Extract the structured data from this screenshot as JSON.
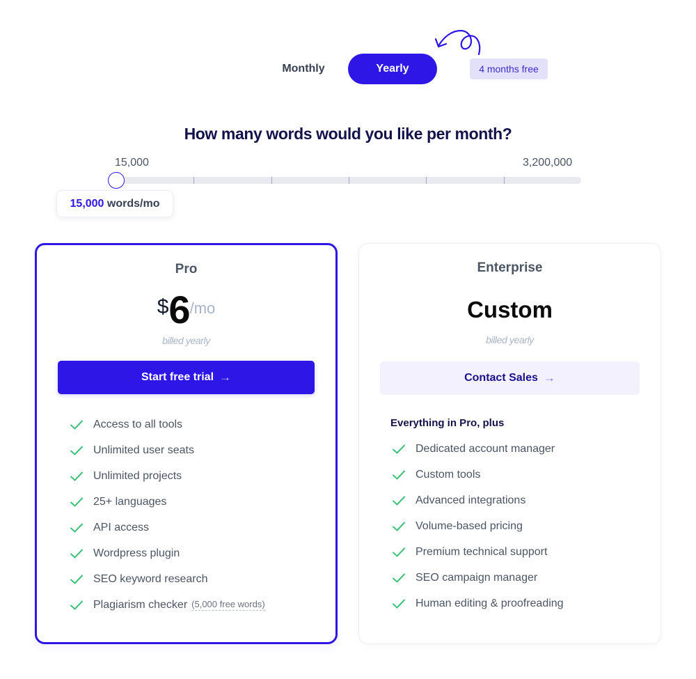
{
  "billing_toggle": {
    "options": [
      {
        "label": "Monthly",
        "selected": false
      },
      {
        "label": "Yearly",
        "selected": true
      }
    ],
    "badge": "4 months free"
  },
  "words": {
    "heading": "How many words would you like per month?",
    "min_label": "15,000",
    "max_label": "3,200,000",
    "tick_count": 5,
    "slider_fraction": 0.0,
    "tooltip_value": "15,000",
    "tooltip_unit": "words/mo"
  },
  "plans": [
    {
      "name": "Pro",
      "currency": "$",
      "amount": "6",
      "period": "/mo",
      "billed": "billed yearly",
      "cta": "Start free trial",
      "features": [
        {
          "label": "Access to all tools"
        },
        {
          "label": "Unlimited user seats"
        },
        {
          "label": "Unlimited projects"
        },
        {
          "label": "25+ languages"
        },
        {
          "label": "API access"
        },
        {
          "label": "Wordpress plugin"
        },
        {
          "label": "SEO keyword research"
        },
        {
          "label": "Plagiarism checker",
          "note": "(5,000 free words)"
        }
      ]
    },
    {
      "name": "Enterprise",
      "price_text": "Custom",
      "billed": "billed yearly",
      "cta": "Contact Sales",
      "features_heading": "Everything in Pro, plus",
      "features": [
        {
          "label": "Dedicated account manager"
        },
        {
          "label": "Custom tools"
        },
        {
          "label": "Advanced integrations"
        },
        {
          "label": "Volume-based pricing"
        },
        {
          "label": "Premium technical support"
        },
        {
          "label": "SEO campaign manager"
        },
        {
          "label": "Human editing & proofreading"
        }
      ]
    }
  ],
  "icons": {
    "cta_arrow": "→",
    "check": "check-icon",
    "annotation": "curly-arrow-icon"
  },
  "colors": {
    "accent": "#2e17e6",
    "check": "#3ec27a",
    "heading": "#14124b",
    "badge_bg": "#e3e1fa"
  }
}
